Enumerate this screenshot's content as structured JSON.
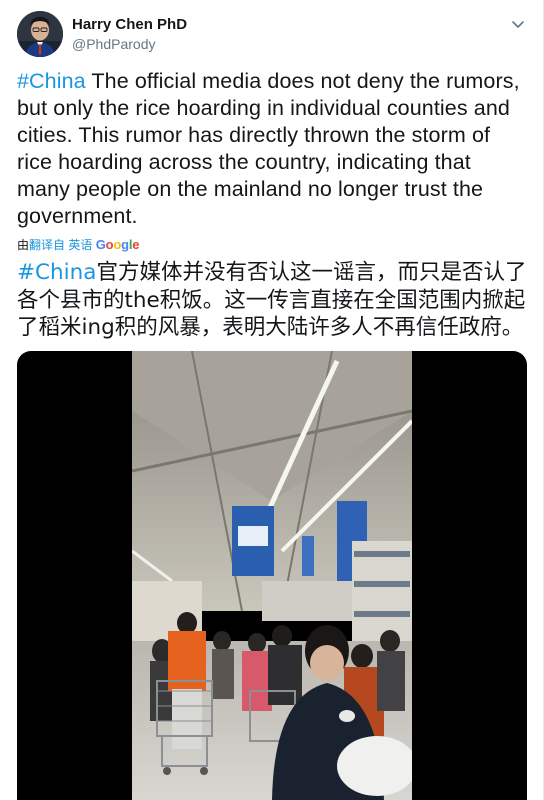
{
  "user": {
    "display_name": "Harry Chen PhD",
    "handle": "@PhdParody",
    "avatar_icon": "user-avatar-icon"
  },
  "menu": {
    "icon": "chevron-down-icon"
  },
  "tweet": {
    "hashtag": "#China",
    "text_en": " The official media does not deny the rumors, but only the rice hoarding in individual counties and cities. This rumor has directly thrown the storm of rice hoarding across the country, indicating that many people on the mainland no longer trust the government.",
    "translated_prefix": "由",
    "translated_link": "翻译自 英语",
    "google_label": "Google",
    "hashtag_zh": "#China",
    "text_zh": "官方媒体并没有否认这一谣言，而只是否认了各个县市的the积饭。这一传言直接在全国范围内掀起了稻米ing积的风暴，表明大陆许多人不再信任政府。"
  },
  "colors": {
    "link": "#1b95e0",
    "text": "#14171a",
    "secondary": "#657786",
    "google_blue": "#4285f4",
    "google_red": "#ea4335",
    "google_yellow": "#fbbc05",
    "google_green": "#34a853"
  }
}
